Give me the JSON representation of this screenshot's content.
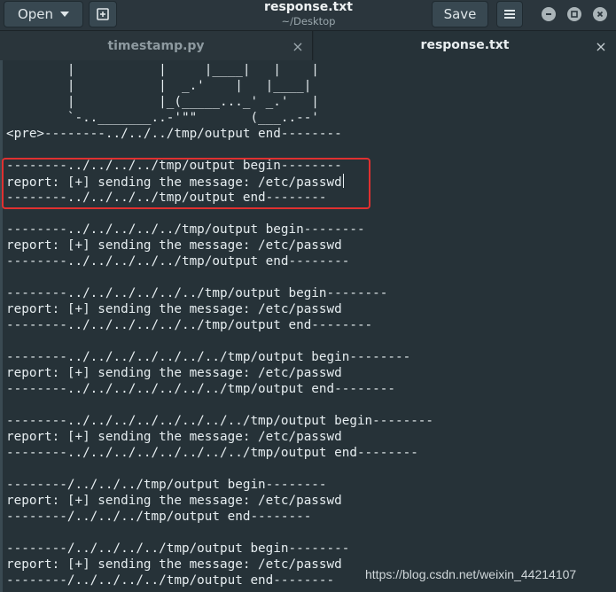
{
  "header": {
    "open_label": "Open",
    "save_label": "Save",
    "title": "response.txt",
    "subtitle": "~/Desktop",
    "icons": [
      "new-document-icon",
      "hamburger-menu-icon",
      "minimize-icon",
      "maximize-icon",
      "close-icon"
    ]
  },
  "tabs": [
    {
      "label": "timestamp.py",
      "active": false
    },
    {
      "label": "response.txt",
      "active": true
    }
  ],
  "editor": {
    "lines": [
      "        |           |     |____|   |    |",
      "        |           |  _.'    |   |____|",
      "        |           |_(_____..._' _.'   |",
      "        `-.._______..-'\"\"       (___..--'",
      "<pre>--------../../../tmp/output end--------",
      "",
      "--------../../../../tmp/output begin--------",
      "report: [+] sending the message: /etc/passwd",
      "--------../../../../tmp/output end--------",
      "",
      "--------../../../../../tmp/output begin--------",
      "report: [+] sending the message: /etc/passwd",
      "--------../../../../../tmp/output end--------",
      "",
      "--------../../../../../../tmp/output begin--------",
      "report: [+] sending the message: /etc/passwd",
      "--------../../../../../../tmp/output end--------",
      "",
      "--------../../../../../../../tmp/output begin--------",
      "report: [+] sending the message: /etc/passwd",
      "--------../../../../../../../tmp/output end--------",
      "",
      "--------../../../../../../../../tmp/output begin--------",
      "report: [+] sending the message: /etc/passwd",
      "--------../../../../../../../../tmp/output end--------",
      "",
      "--------/../../../tmp/output begin--------",
      "report: [+] sending the message: /etc/passwd",
      "--------/../../../tmp/output end--------",
      "",
      "--------/../../../../tmp/output begin--------",
      "report: [+] sending the message: /etc/passwd",
      "--------/../../../../tmp/output end--------"
    ],
    "cursor_line": 7
  },
  "watermark": "https://blog.csdn.net/weixin_44214107",
  "colors": {
    "editor_bg": "#263238",
    "text": "#e6edf0",
    "highlight_border": "#e03030"
  }
}
